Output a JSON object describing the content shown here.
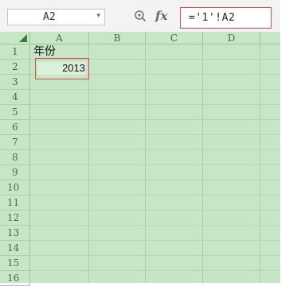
{
  "formula_bar": {
    "name_box": "A2",
    "fx_label": "fx",
    "formula": "='1'!A2"
  },
  "columns": [
    "A",
    "B",
    "C",
    "D"
  ],
  "rows": [
    "1",
    "2",
    "3",
    "4",
    "5",
    "6",
    "7",
    "8",
    "9",
    "10",
    "11",
    "12",
    "13",
    "14",
    "15",
    "16"
  ],
  "cells": {
    "A1": "年份",
    "A2": "2013"
  },
  "colors": {
    "sheet_background": "#c7e6c7",
    "highlight_border": "#e04848"
  }
}
